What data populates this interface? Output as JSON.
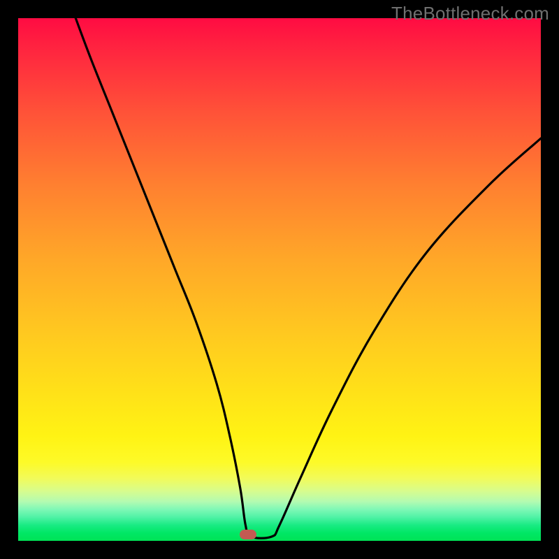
{
  "watermark": "TheBottleneck.com",
  "chart_data": {
    "type": "line",
    "title": "",
    "xlabel": "",
    "ylabel": "",
    "xlim": [
      0,
      100
    ],
    "ylim": [
      0,
      100
    ],
    "background": "rainbow-gradient (red top → green bottom)",
    "series": [
      {
        "name": "bottleneck-curve",
        "x": [
          11,
          14,
          18,
          22,
          26,
          30,
          34,
          38,
          40.5,
          42.5,
          43.5,
          44.5,
          48.5,
          50,
          54,
          60,
          68,
          78,
          90,
          100
        ],
        "y": [
          100,
          92,
          82,
          72,
          62,
          52,
          42,
          30,
          20,
          10,
          3,
          0.8,
          0.8,
          3,
          12,
          25,
          40,
          55,
          68,
          77
        ]
      }
    ],
    "annotations": [
      {
        "name": "optimal-point",
        "x": 44,
        "y": 1.2
      }
    ],
    "gradient_stops": [
      {
        "pct": 0,
        "color": "#ff0b42"
      },
      {
        "pct": 18,
        "color": "#ff5238"
      },
      {
        "pct": 46,
        "color": "#ffa728"
      },
      {
        "pct": 72,
        "color": "#ffe218"
      },
      {
        "pct": 88,
        "color": "#f2fb59"
      },
      {
        "pct": 94,
        "color": "#7ef8b6"
      },
      {
        "pct": 100,
        "color": "#00e356"
      }
    ]
  }
}
